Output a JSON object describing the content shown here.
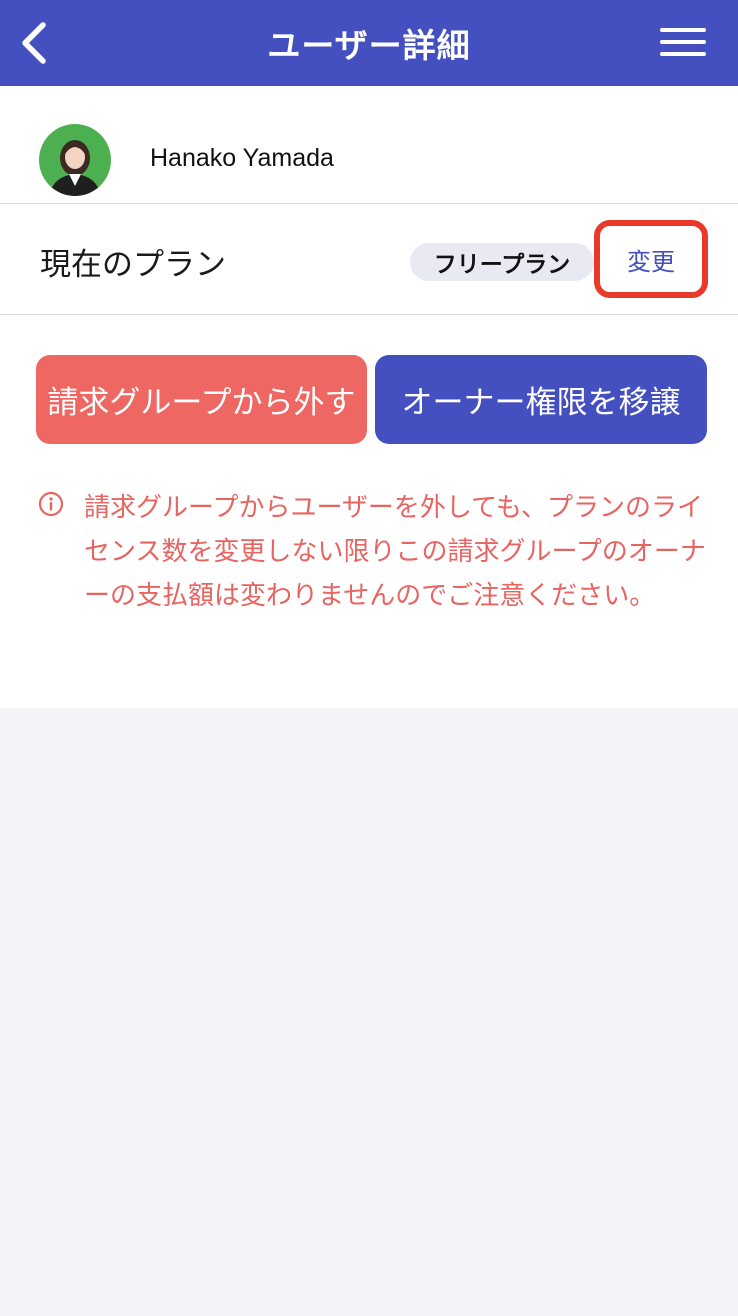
{
  "header": {
    "title": "ユーザー詳細"
  },
  "user": {
    "name": "Hanako Yamada"
  },
  "plan": {
    "label": "現在のプラン",
    "badge": "フリープラン",
    "change_label": "変更"
  },
  "actions": {
    "remove_label": "請求グループから外す",
    "transfer_label": "オーナー権限を移譲"
  },
  "notice": {
    "text": "請求グループからユーザーを外しても、プランのライセンス数を変更しない限りこの請求グループのオーナーの支払額は変わりませんのでご注意ください。"
  },
  "colors": {
    "primary": "#4450bf",
    "danger": "#ee6762",
    "warning_text": "#e76461",
    "highlight": "#e8392a"
  },
  "icons": {
    "back": "chevron-left-icon",
    "menu": "hamburger-menu-icon",
    "info": "info-circle-icon"
  }
}
